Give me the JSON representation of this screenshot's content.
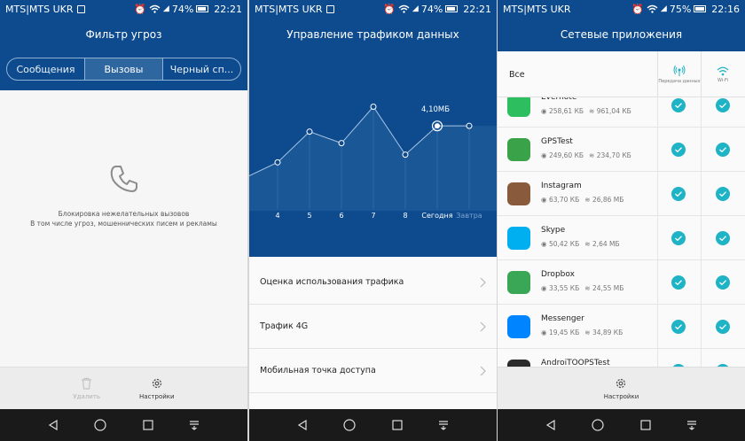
{
  "screens": [
    {
      "status": {
        "carrier": "MTS|MTS UKR",
        "battery": "74%",
        "time": "22:21"
      },
      "title": "Фильтр угроз",
      "tabs": [
        {
          "label": "Сообщения",
          "active": false
        },
        {
          "label": "Вызовы",
          "active": true
        },
        {
          "label": "Черный сп...",
          "active": false
        }
      ],
      "empty_message_line1": "Блокировка нежелательных вызовов",
      "empty_message_line2": "В том числе угроз, мошеннических писем и рекламы",
      "bottom": {
        "delete_label": "Удалить",
        "settings_label": "Настройки"
      }
    },
    {
      "status": {
        "carrier": "MTS|MTS UKR",
        "battery": "74%",
        "time": "22:21"
      },
      "title": "Управление трафиком данных",
      "menu": [
        {
          "label": "Оценка использования трафика"
        },
        {
          "label": "Трафик 4G"
        },
        {
          "label": "Мобильная точка доступа"
        }
      ]
    },
    {
      "status": {
        "carrier": "MTS|MTS UKR",
        "battery": "75%",
        "time": "22:16"
      },
      "title": "Сетевые приложения",
      "header": {
        "all_label": "Все",
        "mobile_label": "Передача данных",
        "wifi_label": "Wi-Fi"
      },
      "apps": [
        {
          "name": "Evernote",
          "mobile": "258,61 КБ",
          "wifi": "961,04 КБ",
          "color": "#2dbe60"
        },
        {
          "name": "GPSTest",
          "mobile": "249,60 КБ",
          "wifi": "234,70 КБ",
          "color": "#3aa34a"
        },
        {
          "name": "Instagram",
          "mobile": "63,70 КБ",
          "wifi": "26,86 МБ",
          "color": "#8a5a3c"
        },
        {
          "name": "Skype",
          "mobile": "50,42 КБ",
          "wifi": "2,64 МБ",
          "color": "#00aff0"
        },
        {
          "name": "Dropbox",
          "mobile": "33,55 КБ",
          "wifi": "24,55 МБ",
          "color": "#3aa757"
        },
        {
          "name": "Messenger",
          "mobile": "19,45 КБ",
          "wifi": "34,89 КБ",
          "color": "#0084ff"
        },
        {
          "name": "AndroiTOOPSTest",
          "mobile": "",
          "wifi": "",
          "color": "#2b2b2b"
        }
      ],
      "bottom": {
        "settings_label": "Настройки"
      }
    }
  ],
  "chart_data": {
    "type": "line",
    "categories": [
      "4",
      "5",
      "6",
      "7",
      "8",
      "Сегодня",
      "Завтра"
    ],
    "values": [
      1.6,
      3.2,
      2.6,
      4.5,
      2.0,
      3.5,
      3.5
    ],
    "annotation": "4,10МБ",
    "highlight_category": "Сегодня",
    "ylim": [
      0,
      6
    ],
    "colors": {
      "background": "#0d4b8e",
      "line": "#a9c4e3",
      "point": "#ffffff",
      "future_label": "#7ea3cf"
    }
  }
}
